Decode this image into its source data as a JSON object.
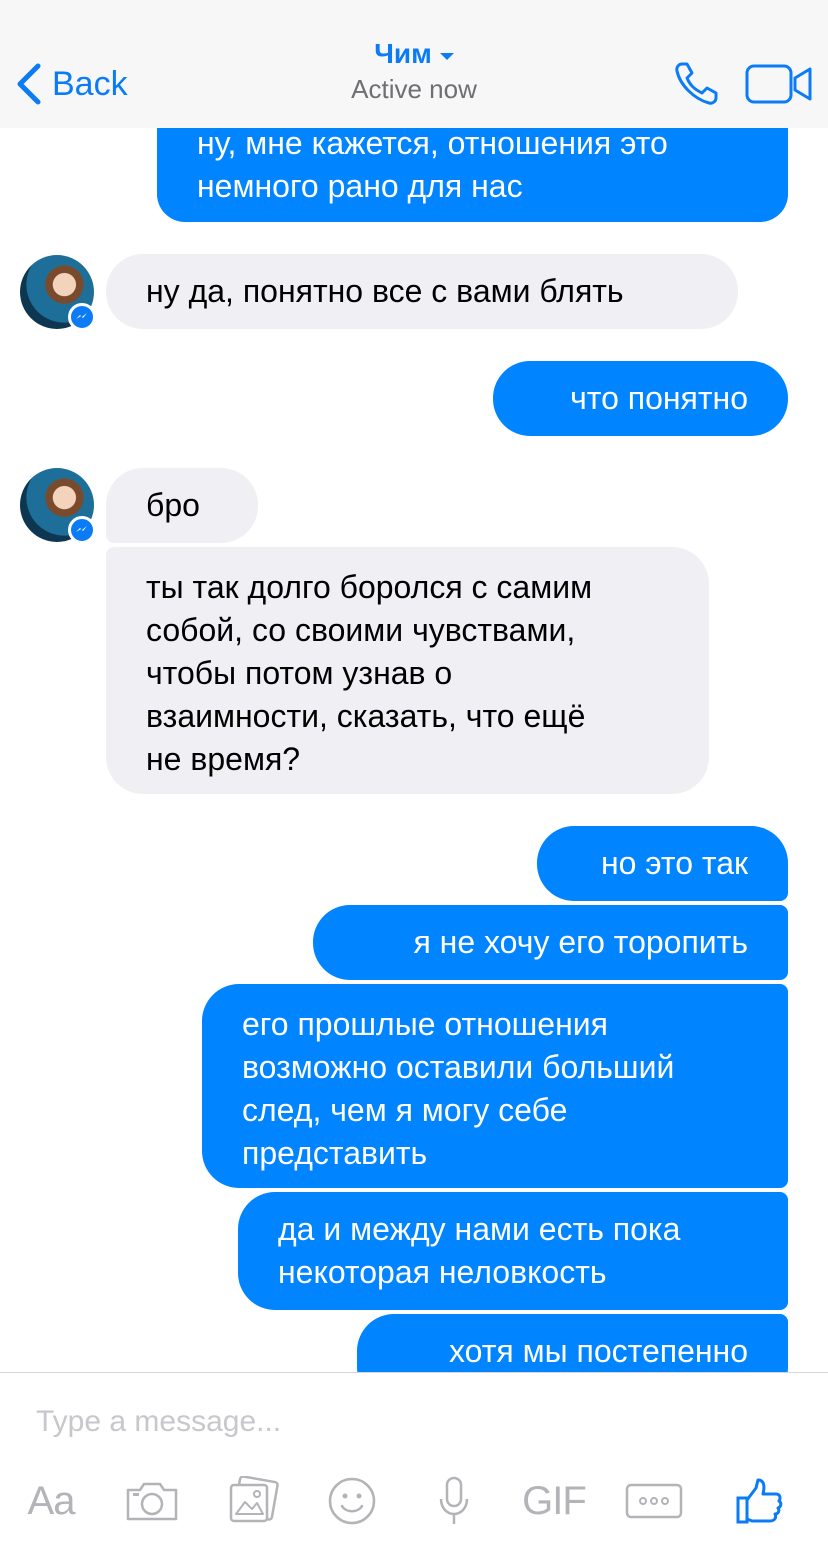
{
  "header": {
    "back_label": "Back",
    "contact_name": "Чим",
    "status": "Active now",
    "icons": [
      "chevron-left-icon",
      "caret-down-icon",
      "phone-icon",
      "video-camera-icon"
    ]
  },
  "messages": [
    {
      "direction": "out",
      "text": "ну, мне кажется, отношения это\nнемного рано для нас"
    },
    {
      "direction": "in",
      "text": "ну да, понятно все с вами блять"
    },
    {
      "direction": "out",
      "text": "что понятно"
    },
    {
      "direction": "in",
      "text": "бро"
    },
    {
      "direction": "in",
      "text": "ты так долго боролся с самим\nсобой, со своими чувствами,\nчтобы потом узнав о\nвзаимности, сказать, что ещё\nне время?"
    },
    {
      "direction": "out",
      "text": "но это так"
    },
    {
      "direction": "out",
      "text": "я не хочу его торопить"
    },
    {
      "direction": "out",
      "text": "его прошлые отношения\nвозможно оставили больший\nслед, чем я могу себе\nпредставить"
    },
    {
      "direction": "out",
      "text": "да и между нами есть пока\nнекоторая неловкость"
    },
    {
      "direction": "out",
      "text": "хотя мы постепенно"
    }
  ],
  "composer": {
    "placeholder": "Type a message...",
    "text_format_label": "Aa",
    "gif_label": "GIF",
    "tools": [
      "text-format",
      "camera-icon",
      "gallery-icon",
      "emoji-icon",
      "microphone-icon",
      "gif",
      "more-icon",
      "thumbs-up-icon"
    ]
  },
  "colors": {
    "accent": "#0b7cf5",
    "outgoing_bubble": "#0084ff",
    "incoming_bubble": "#efeff4",
    "toolbar_icon": "#b3b3b8"
  }
}
